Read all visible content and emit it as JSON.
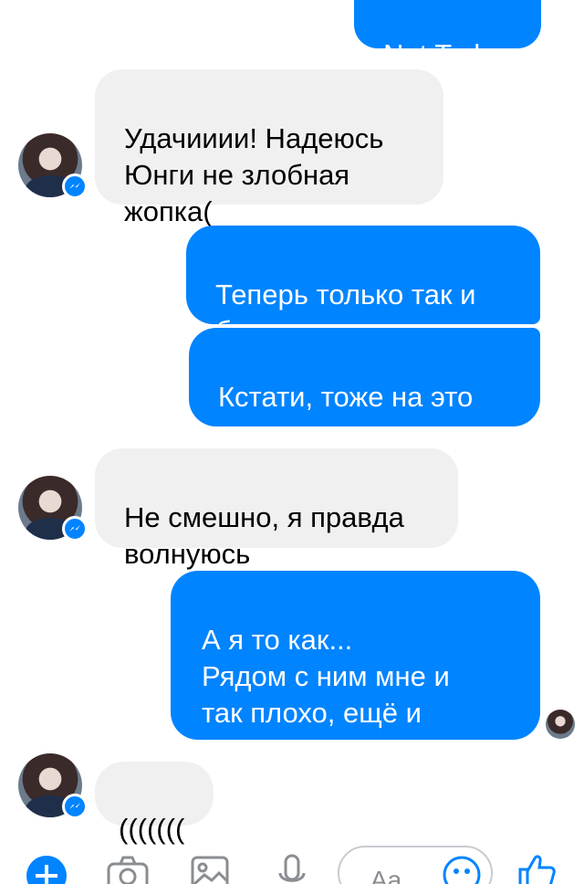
{
  "messages": [
    {
      "text": "Not Today"
    },
    {
      "text": "Удачииии! Надеюсь\nЮнги не злобная\nжопка("
    },
    {
      "text": "Теперь только так и\nбуду его называть"
    },
    {
      "text": "Кстати, тоже на это\nнадеюсь"
    },
    {
      "text": "Не смешно, я правда\nволнуюсь"
    },
    {
      "text": "А я то как...\nРядом с ним мне и\nтак плохо, ещё и\nизвиняться придётся"
    },
    {
      "text": "((((((("
    }
  ],
  "composer": {
    "placeholder": "Aa"
  },
  "colors": {
    "accent": "#0084ff",
    "incoming": "#f1f0f0"
  },
  "icons": [
    "plus-icon",
    "camera-icon",
    "image-icon",
    "microphone-icon",
    "emoji-icon",
    "like-icon",
    "messenger-badge-icon"
  ]
}
